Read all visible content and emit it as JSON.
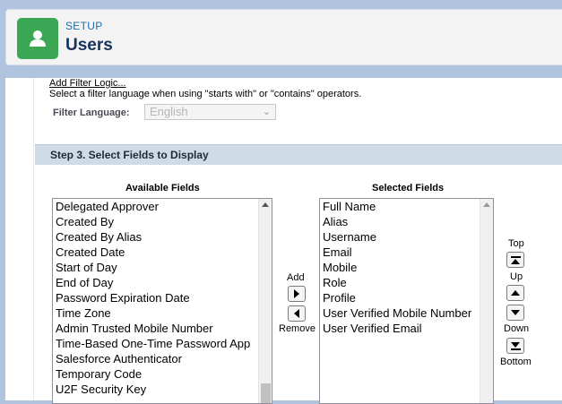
{
  "header": {
    "breadcrumb": "SETUP",
    "title": "Users",
    "icon": "user-icon",
    "icon_color": "#3ba755"
  },
  "filter": {
    "add_logic_link": "Add Filter Logic...",
    "help_text": "Select a filter language when using \"starts with\" or \"contains\" operators.",
    "language_label": "Filter Language:",
    "language_value": "English"
  },
  "step3": {
    "title": "Step 3. Select Fields to Display"
  },
  "available": {
    "label": "Available Fields",
    "items": [
      "Delegated Approver",
      "Created By",
      "Created By Alias",
      "Created Date",
      "Start of Day",
      "End of Day",
      "Password Expiration Date",
      "Time Zone",
      "Admin Trusted Mobile Number",
      "Time-Based One-Time Password App",
      "Salesforce Authenticator",
      "Temporary Code",
      "U2F Security Key"
    ]
  },
  "selected": {
    "label": "Selected Fields",
    "items": [
      "Full Name",
      "Alias",
      "Username",
      "Email",
      "Mobile",
      "Role",
      "Profile",
      "User Verified Mobile Number",
      "User Verified Email"
    ]
  },
  "controls": {
    "add": "Add",
    "remove": "Remove",
    "top": "Top",
    "up": "Up",
    "down": "Down",
    "bottom": "Bottom"
  }
}
